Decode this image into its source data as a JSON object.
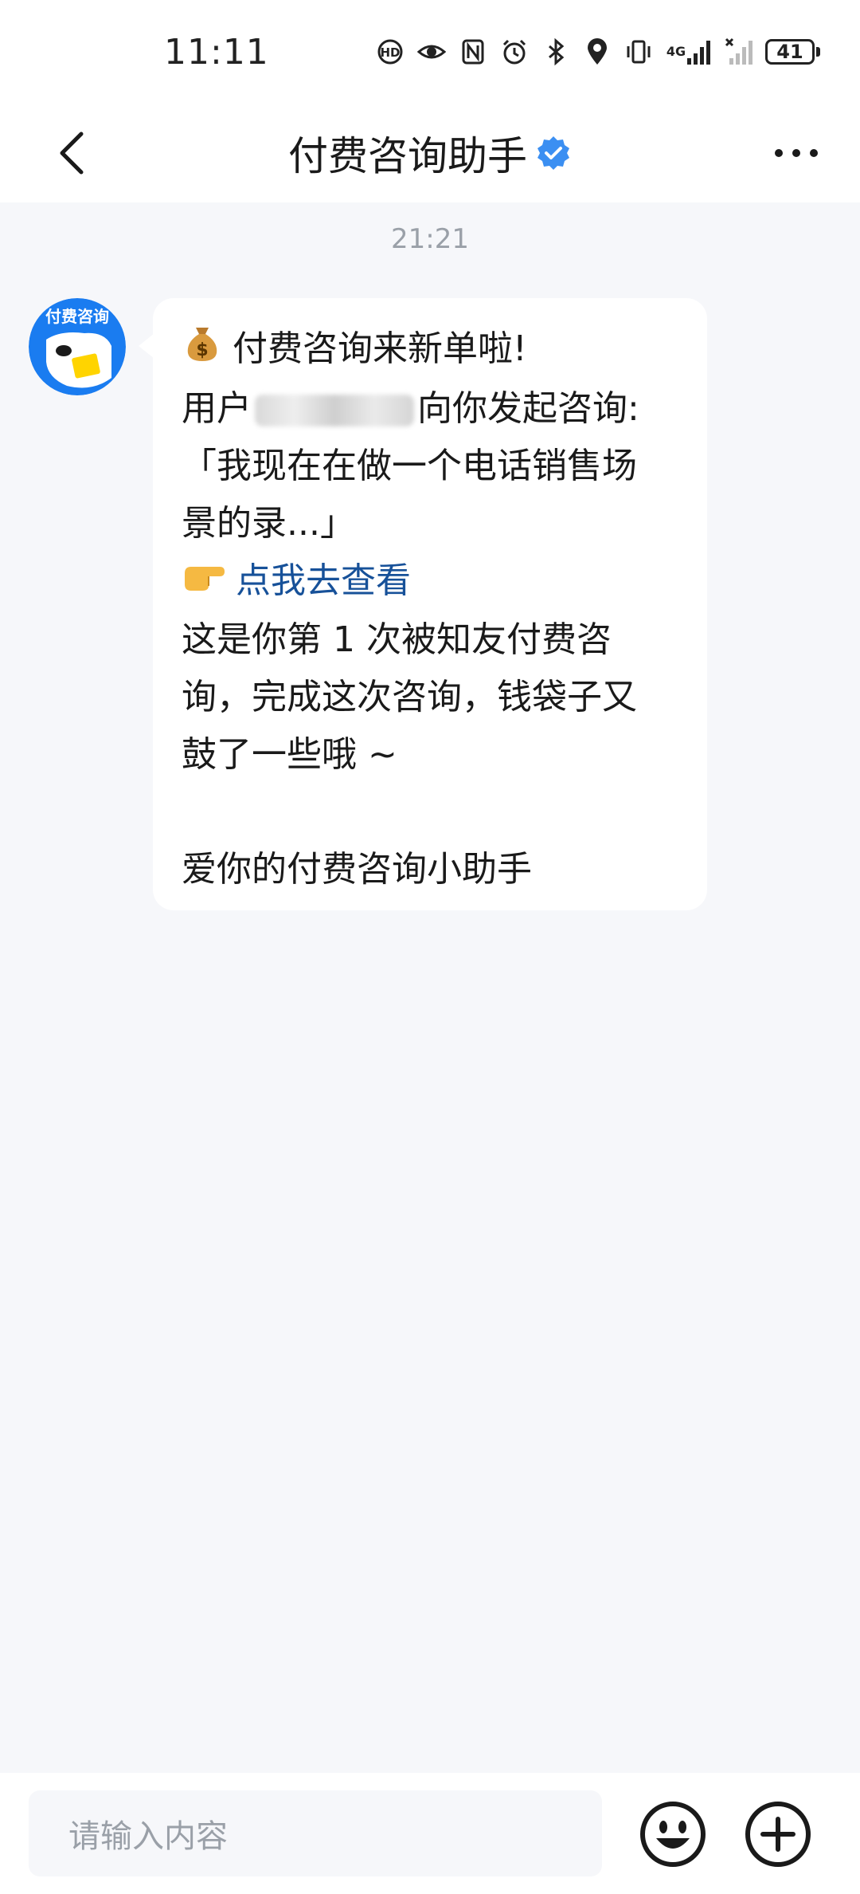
{
  "status_bar": {
    "time": "11:11",
    "network_label": "4G",
    "battery": "41",
    "icons": [
      "hd-call-icon",
      "eye-icon",
      "nfc-icon",
      "alarm-icon",
      "bluetooth-icon",
      "location-icon",
      "vibrate-icon",
      "signal-icon",
      "no-signal-icon",
      "battery-icon"
    ]
  },
  "header": {
    "title": "付费咨询助手",
    "back_icon": "chevron-left-icon",
    "verified_icon": "verified-badge-icon",
    "more_icon": "more-dots-icon"
  },
  "chat": {
    "timestamp": "21:21",
    "avatar_text": "付费咨询",
    "message": {
      "line1": "付费咨询来新单啦!",
      "line2_prefix": "用户",
      "line2_suffix": "向你发起咨询:",
      "line3": "「我现在在做一个电话销售场",
      "line4": "景的录...」",
      "link_text": "点我去查看",
      "line6": "这是你第 1 次被知友付费咨",
      "line7": "询，完成这次咨询，钱袋子又",
      "line8": "鼓了一些哦 ~",
      "signature": "爱你的付费咨询小助手"
    }
  },
  "input_bar": {
    "placeholder": "请输入内容",
    "emoji_icon": "smiley-icon",
    "plus_icon": "plus-circle-icon"
  },
  "colors": {
    "link": "#175199",
    "verified": "#3b8ff2",
    "avatar_bg": "#1a7cf0",
    "background": "#f6f7fa"
  }
}
